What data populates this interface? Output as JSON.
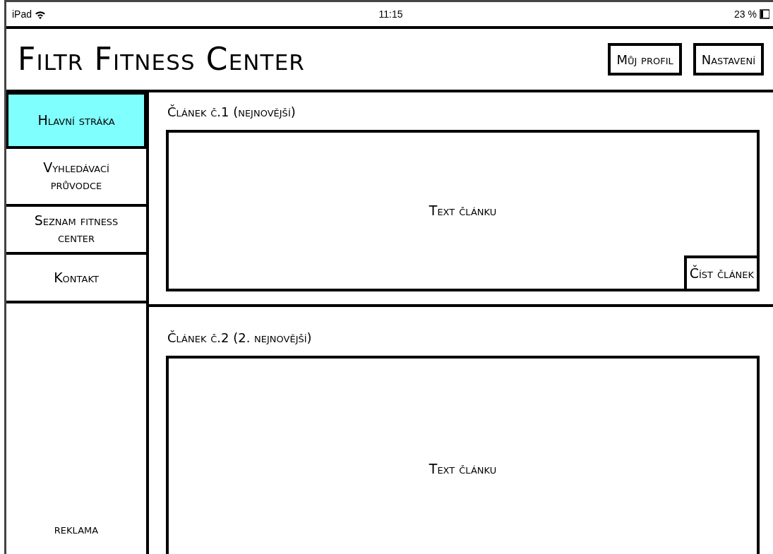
{
  "status_bar": {
    "device": "iPad",
    "time": "11:15",
    "battery": "23 %"
  },
  "header": {
    "title": "Filtr Fitness Center",
    "buttons": [
      "Můj profil",
      "Nastavení"
    ]
  },
  "nav": {
    "items": [
      {
        "label": "Hlavní stráka",
        "selected": true
      },
      {
        "label": "Vyhledávací průvodce",
        "selected": false
      },
      {
        "label": "Seznam fitness center",
        "selected": false
      },
      {
        "label": "Kontakt",
        "selected": false
      }
    ]
  },
  "ad": {
    "label": "reklama"
  },
  "articles": [
    {
      "heading": "Článek č.1 (nejnovější)",
      "body": "Text článku",
      "button": "Číst článek"
    },
    {
      "heading": "Článek č.2 (2. nejnovější)",
      "body": "Text článku"
    }
  ]
}
